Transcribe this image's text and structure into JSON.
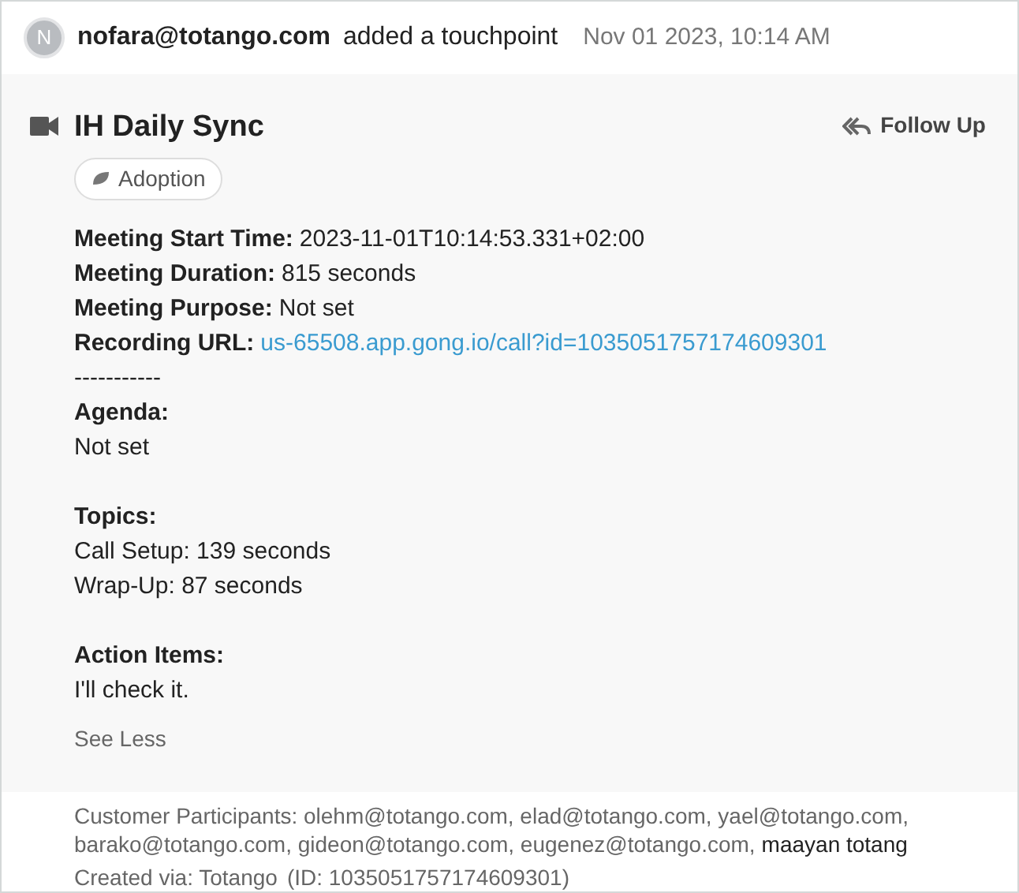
{
  "header": {
    "avatar": "N",
    "actor": "nofara@totango.com",
    "action": "added a touchpoint",
    "timestamp": "Nov 01 2023, 10:14 AM"
  },
  "touchpoint": {
    "title": "IH Daily Sync",
    "tag": "Adoption",
    "follow_up": "Follow Up",
    "fields": [
      {
        "kind": "text",
        "label": "Meeting Start Time:",
        "value": "2023-11-01T10:14:53.331+02:00"
      },
      {
        "kind": "text",
        "label": "Meeting Duration:",
        "value": "815 seconds"
      },
      {
        "kind": "text",
        "label": "Meeting Purpose:",
        "value": "Not set"
      },
      {
        "kind": "link",
        "label": "Recording URL:",
        "value": "us-65508.app.gong.io/call?id=1035051757174609301"
      }
    ],
    "separator": "-----------",
    "sections": [
      {
        "heading": "Agenda:",
        "lines": [
          "Not set"
        ]
      },
      {
        "heading": "Topics:",
        "lines": [
          "Call Setup: 139 seconds",
          "Wrap-Up: 87 seconds"
        ]
      },
      {
        "heading": "Action Items:",
        "lines": [
          "I'll check it."
        ]
      }
    ],
    "see_less": "See Less"
  },
  "footer": {
    "participants_lines": [
      "Customer Participants: olehm@totango.com, elad@totango.com, yael@totango.com,",
      "barako@totango.com, gideon@totango.com, eugenez@totango.com,"
    ],
    "participants_highlight": "maayan totang",
    "created_via": "Created via: Totango",
    "id": "(ID: 1035051757174609301)"
  }
}
